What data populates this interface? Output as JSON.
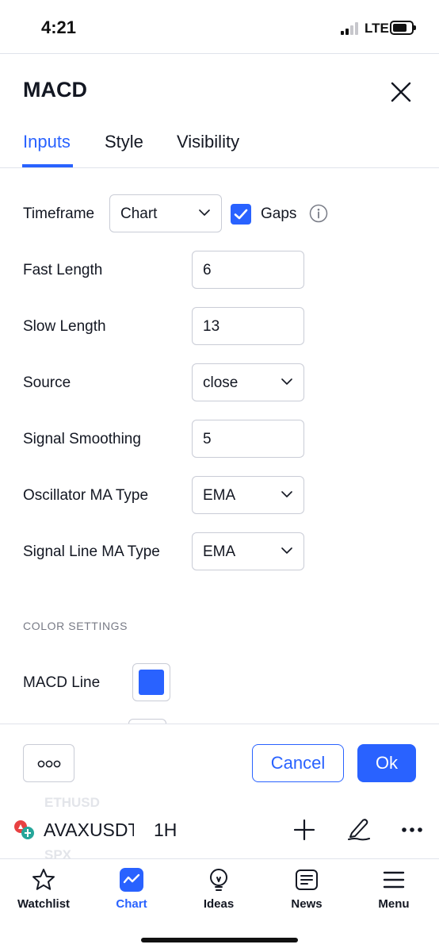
{
  "status_bar": {
    "time": "4:21",
    "network": "LTE"
  },
  "dialog": {
    "title": "MACD",
    "tabs": [
      {
        "label": "Inputs",
        "active": true
      },
      {
        "label": "Style",
        "active": false
      },
      {
        "label": "Visibility",
        "active": false
      }
    ],
    "inputs": {
      "timeframe": {
        "label": "Timeframe",
        "value": "Chart",
        "gaps_label": "Gaps",
        "gaps_checked": true
      },
      "fast_length": {
        "label": "Fast Length",
        "value": "6"
      },
      "slow_length": {
        "label": "Slow Length",
        "value": "13"
      },
      "source": {
        "label": "Source",
        "value": "close"
      },
      "signal_smoothing": {
        "label": "Signal Smoothing",
        "value": "5"
      },
      "oscillator_ma_type": {
        "label": "Oscillator MA Type",
        "value": "EMA"
      },
      "signal_line_ma_type": {
        "label": "Signal Line MA Type",
        "value": "EMA"
      }
    },
    "color_settings": {
      "section_title": "COLOR SETTINGS",
      "macd_line": {
        "label": "MACD Line",
        "color": "#2962ff"
      }
    },
    "footer": {
      "cancel_label": "Cancel",
      "ok_label": "Ok"
    }
  },
  "chart_toolbar": {
    "ghost_symbol_above": "ETHUSD",
    "symbol": "AVAXUSDT",
    "ghost_symbol_below": "SPX",
    "interval": "1H"
  },
  "bottom_nav": [
    {
      "label": "Watchlist",
      "icon": "star-icon",
      "active": false
    },
    {
      "label": "Chart",
      "icon": "chart-icon",
      "active": true
    },
    {
      "label": "Ideas",
      "icon": "lightbulb-icon",
      "active": false
    },
    {
      "label": "News",
      "icon": "news-icon",
      "active": false
    },
    {
      "label": "Menu",
      "icon": "menu-icon",
      "active": false
    }
  ],
  "colors": {
    "accent": "#2962ff",
    "text": "#131722",
    "muted": "#787b86",
    "border": "#c9ccd6"
  }
}
